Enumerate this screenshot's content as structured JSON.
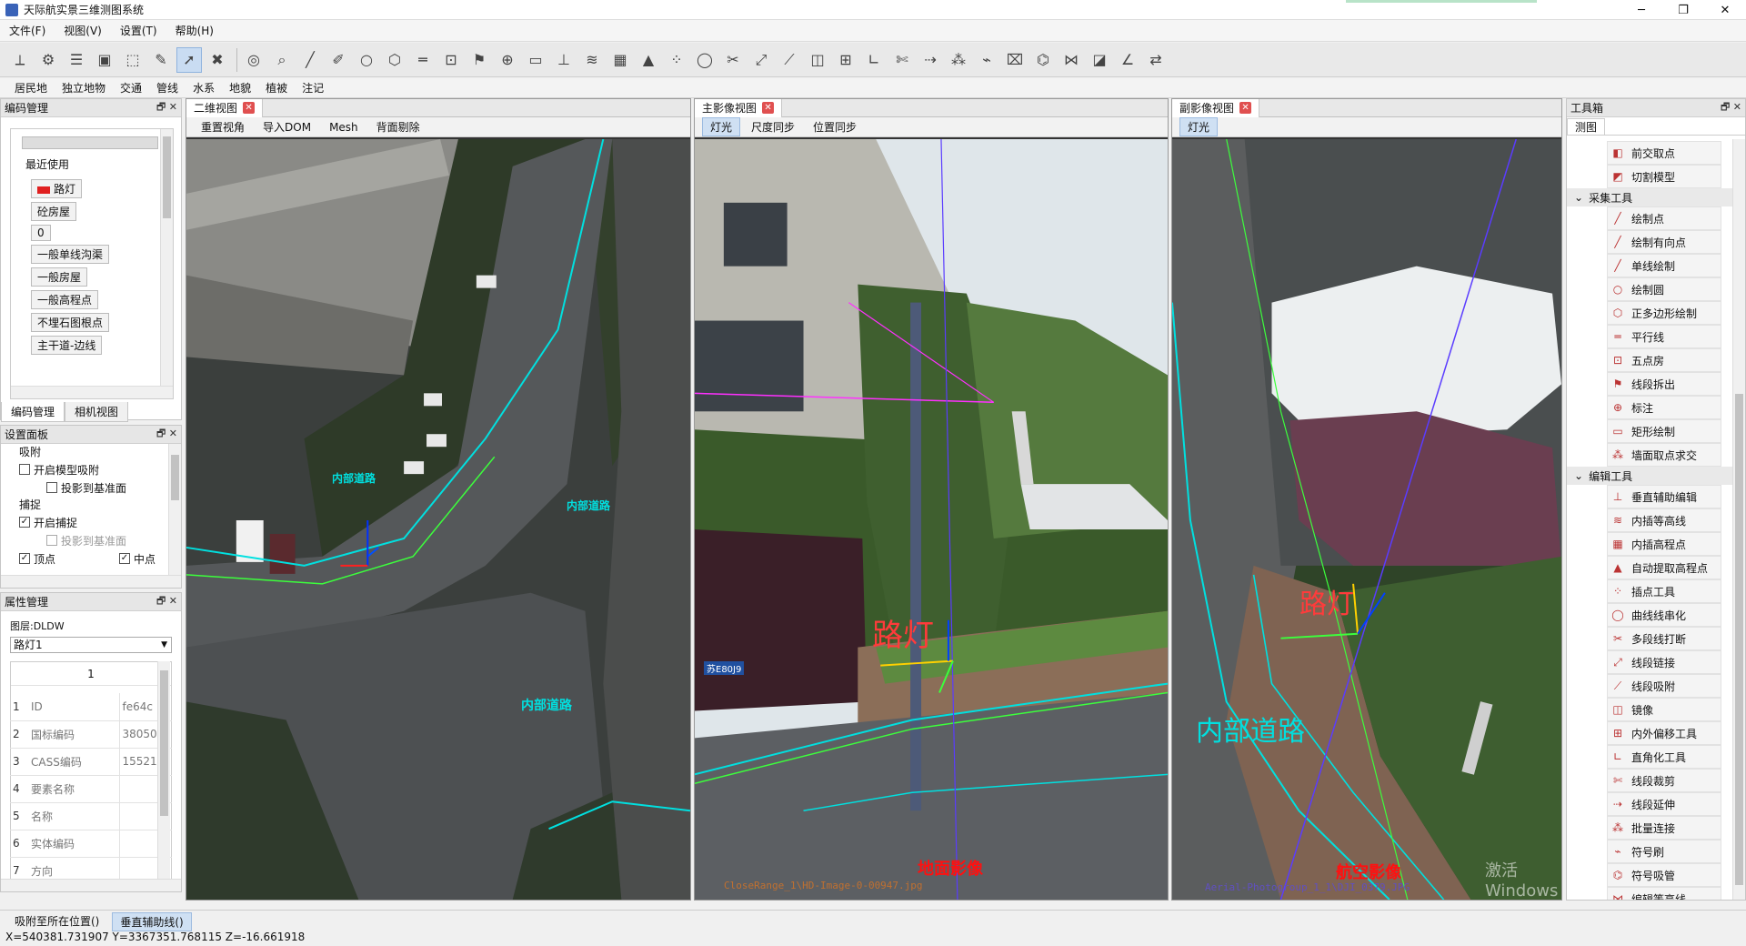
{
  "window": {
    "title": "天际航实景三维测图系统"
  },
  "menu": [
    "文件(F)",
    "视图(V)",
    "设置(T)",
    "帮助(H)"
  ],
  "layers": [
    "居民地",
    "独立地物",
    "交通",
    "管线",
    "水系",
    "地貌",
    "植被",
    "注记"
  ],
  "code_panel": {
    "title": "编码管理",
    "recent_label": "最近使用",
    "items": [
      "路灯",
      "砼房屋",
      "0",
      "一般单线沟渠",
      "一般房屋",
      "一般高程点",
      "不埋石图根点",
      "主干道-边线"
    ],
    "tabs": [
      "编码管理",
      "相机视图"
    ]
  },
  "settings_panel": {
    "title": "设置面板",
    "groups": [
      {
        "name": "吸附",
        "items": [
          {
            "label": "开启模型吸附",
            "checked": false,
            "indent": 0,
            "disabled": false
          },
          {
            "label": "投影到基准面",
            "checked": false,
            "indent": 1,
            "disabled": false
          }
        ]
      },
      {
        "name": "捕捉",
        "items": [
          {
            "label": "开启捕捉",
            "checked": true,
            "indent": 0,
            "disabled": false
          },
          {
            "label": "投影到基准面",
            "checked": false,
            "indent": 1,
            "disabled": true
          }
        ]
      }
    ],
    "last_row": [
      {
        "label": "顶点",
        "checked": true
      },
      {
        "label": "中点",
        "checked": true
      }
    ]
  },
  "attr_panel": {
    "title": "属性管理",
    "layer_label": "图层:DLDW",
    "selected": "路灯1",
    "column_header": "1",
    "rows": [
      {
        "n": "1",
        "k": "ID",
        "v": "fe64c"
      },
      {
        "n": "2",
        "k": "国标编码",
        "v": "38050"
      },
      {
        "n": "3",
        "k": "CASS编码",
        "v": "15521"
      },
      {
        "n": "4",
        "k": "要素名称",
        "v": ""
      },
      {
        "n": "5",
        "k": "名称",
        "v": ""
      },
      {
        "n": "6",
        "k": "实体编码",
        "v": ""
      },
      {
        "n": "7",
        "k": "方向",
        "v": ""
      }
    ]
  },
  "view2d": {
    "tab": "二维视图",
    "buttons": [
      "重置视角",
      "导入DOM",
      "Mesh",
      "背面剔除"
    ],
    "labels": [
      "内部道路",
      "内部道路",
      "内部道路"
    ]
  },
  "view_main": {
    "tab": "主影像视图",
    "buttons": [
      "灯光",
      "尺度同步",
      "位置同步"
    ],
    "feature_label": "路灯",
    "caption": "地面影像",
    "filename": "CloseRange_1\\HD-Image-0-00947.jpg",
    "plate": "苏E80J9"
  },
  "view_sub": {
    "tab": "副影像视图",
    "buttons": [
      "灯光"
    ],
    "feature_label": "路灯",
    "road_label": "内部道路",
    "caption": "航空影像",
    "filename": "Aerial-Photogroup_1_1\\DJI_0379.JPG"
  },
  "toolbox": {
    "title": "工具箱",
    "tab": "测图",
    "top_items": [
      "前交取点",
      "切割模型"
    ],
    "groups": [
      {
        "name": "采集工具",
        "items": [
          "绘制点",
          "绘制有向点",
          "单线绘制",
          "绘制圆",
          "正多边形绘制",
          "平行线",
          "五点房",
          "线段拆出",
          "标注",
          "矩形绘制",
          "墙面取点求交"
        ]
      },
      {
        "name": "编辑工具",
        "items": [
          "垂直辅助编辑",
          "内插等高线",
          "内插高程点",
          "自动提取高程点",
          "插点工具",
          "曲线线串化",
          "多段线打断",
          "线段链接",
          "线段吸附",
          "镜像",
          "内外偏移工具",
          "直角化工具",
          "线段裁剪",
          "线段延伸",
          "批量连接",
          "符号刷",
          "符号吸管",
          "编辑等高线"
        ]
      }
    ]
  },
  "status": {
    "buttons": [
      "吸附至所在位置()",
      "垂直辅助线()"
    ],
    "coords": "X=540381.731907  Y=3367351.768115  Z=-16.661918"
  },
  "watermark": "激活 Windows",
  "colors": {
    "accent": "#00e0e0",
    "feature": "#ff3b3b",
    "line": "#3cff3c",
    "caption": "#ff1010",
    "selection": "#c9dcf2"
  }
}
